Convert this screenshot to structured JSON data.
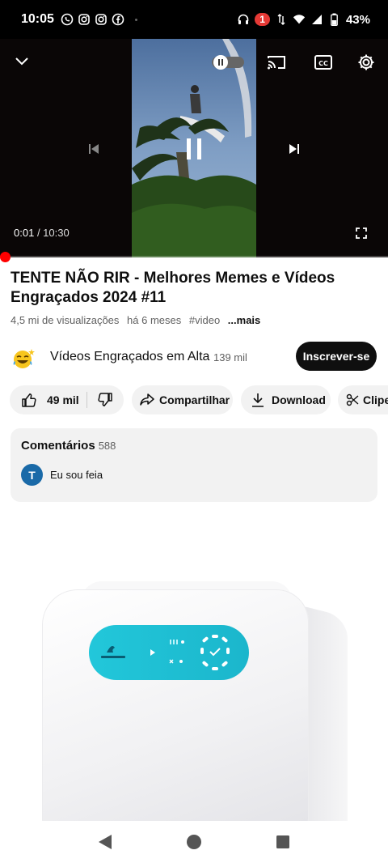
{
  "status_bar": {
    "time": "10:05",
    "icons": [
      "whatsapp-icon",
      "instagram-icon",
      "instagram-icon",
      "facebook-icon"
    ],
    "notification_count": "1",
    "battery": "43%"
  },
  "player": {
    "current_time": "0:01",
    "total_time": "/ 10:30",
    "progress": 0.0016
  },
  "video": {
    "title": "TENTE NÃO RIR - Melhores Memes e Vídeos Engraçados 2024 #11",
    "views": "4,5 mi de visualizações",
    "age": "há 6 meses",
    "hashtag": "#video",
    "more": "...mais"
  },
  "channel": {
    "name": "Vídeos Engraçados em Alta",
    "subscribers": "139 mil",
    "subscribe_label": "Inscrever-se"
  },
  "actions": {
    "likes": "49 mil",
    "share": "Compartilhar",
    "download": "Download",
    "clip": "Clipe"
  },
  "comments": {
    "heading": "Comentários",
    "count": "588",
    "avatar_letter": "T",
    "top_comment": "Eu sou feia"
  },
  "colors": {
    "accent": "#ff0000",
    "subscribe_bg": "#0f0f0f",
    "pill_bg": "#f2f2f2",
    "comment_avatar": "#1a6aa8",
    "ad_panel": "#1fc0d6"
  }
}
